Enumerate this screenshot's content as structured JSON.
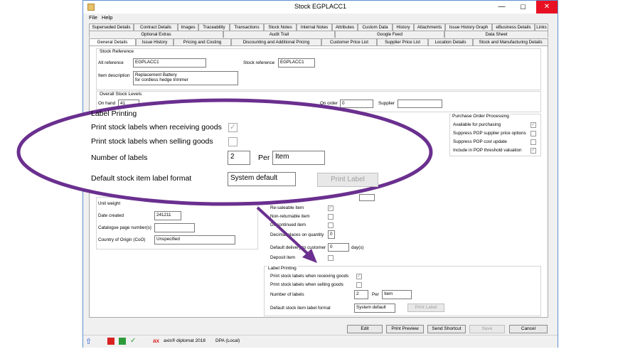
{
  "window": {
    "title": "Stock EGPLACC1",
    "minimize": "—",
    "maximize": "☐",
    "close": "✕"
  },
  "menu": [
    "File",
    "Help"
  ],
  "tabs_row1": [
    "Superseded Details",
    "Contract Details",
    "Images",
    "Traceability",
    "Transactions",
    "Stock Notes",
    "Internal Notes",
    "Attributes",
    "Custom Data",
    "History",
    "Attachments",
    "Issue History Graph",
    "eBusiness Details",
    "Links"
  ],
  "tabs_row2": [
    "Optional Extras",
    "Audit Trail",
    "Google Feed",
    "Data Sheet"
  ],
  "tabs_row3": [
    "General Details",
    "Issue History",
    "Pricing and Costing",
    "Discounting and Additional Pricing",
    "Customer Price List",
    "Supplier Price List",
    "Location Details",
    "Stock and Manufacturing Details"
  ],
  "stock_reference": {
    "group_label": "Stock Reference",
    "alt_reference_label": "Alt reference",
    "alt_reference_value": "EGPLACC1",
    "stock_reference_label": "Stock reference",
    "stock_reference_value": "EGPLACC1",
    "item_description_label": "Item description",
    "item_description_line1": "Replacement Battery",
    "item_description_line2": "for cordless hedge trimmer"
  },
  "overall_stock": {
    "group_label": "Overall Stock Levels",
    "on_hand_label": "On hand",
    "on_hand_value": "41",
    "on_order_label": "On order",
    "on_order_value": "0",
    "supplier_label": "Supplier",
    "supplier_value": ""
  },
  "purchase_order": {
    "group_label": "Purchase Order Processing",
    "items": [
      "Available for purchasing",
      "Suppress POP supplier price options",
      "Suppress POP cost update",
      "Include in POP threshold valuation"
    ],
    "checks": [
      "✓",
      "",
      "",
      "✓"
    ]
  },
  "details": {
    "unit_weight_label": "Unit weight",
    "date_created_label": "Date created",
    "date_created_value": "241211",
    "catalogue_label": "Catalogue page number(s)",
    "country_label": "Country of Origin (CoO)",
    "country_value": "Unspecified"
  },
  "flags": {
    "items": [
      "Re-saleable item",
      "Non-returnable item",
      "Discontinued item",
      "Decimal places on quantity",
      "Default delivery to customer",
      "Deposit item"
    ],
    "resaleable_check": "✓",
    "decimal_value": "0",
    "default_value": "0",
    "days_label": "day(s)"
  },
  "label_printing": {
    "group_label": "Label Printing",
    "receiving_label": "Print stock labels when receiving goods",
    "receiving_check": "✓",
    "selling_label": "Print stock labels when selling goods",
    "number_label": "Number of labels",
    "number_value": "2",
    "per_label": "Per",
    "per_value": "Item",
    "format_label": "Default stock item label format",
    "format_value": "System default",
    "print_button": "Print Label"
  },
  "buttons": {
    "edit": "Edit",
    "print_preview": "Print Preview",
    "send_shortcut": "Send Shortcut",
    "save": "Save",
    "cancel": "Cancel"
  },
  "status": {
    "product": "axis® diplomat 2018",
    "database": "DPA (Local)"
  },
  "colors": {
    "callout": "#6a2f8f",
    "close": "#e81123",
    "window_border": "#5b8fd1"
  }
}
